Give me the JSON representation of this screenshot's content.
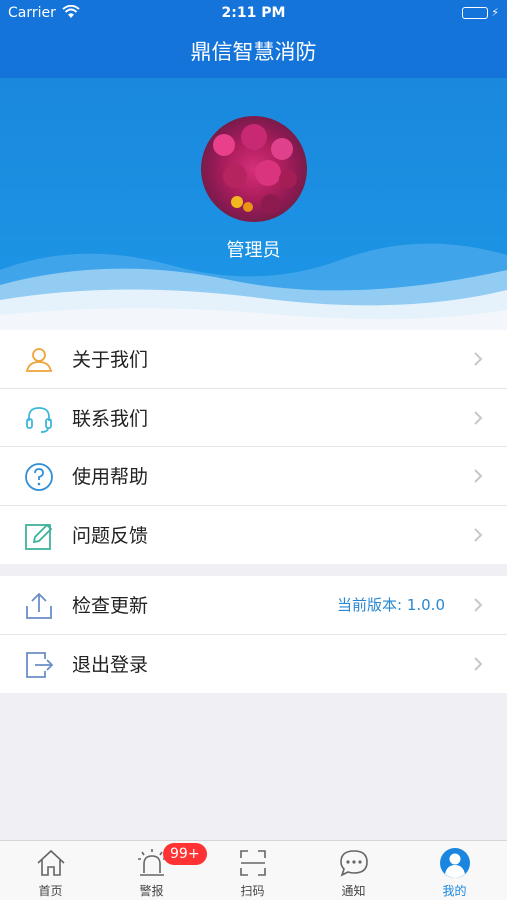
{
  "statusbar": {
    "carrier": "Carrier",
    "time": "2:11 PM"
  },
  "app": {
    "title": "鼎信智慧消防"
  },
  "profile": {
    "username": "管理员"
  },
  "menu_group_1": [
    {
      "label": "关于我们",
      "icon": "user-icon"
    },
    {
      "label": "联系我们",
      "icon": "headset-icon"
    },
    {
      "label": "使用帮助",
      "icon": "help-icon"
    },
    {
      "label": "问题反馈",
      "icon": "edit-icon"
    }
  ],
  "menu_group_2": [
    {
      "label": "检查更新",
      "icon": "upload-icon",
      "value": "当前版本: 1.0.0"
    },
    {
      "label": "退出登录",
      "icon": "logout-icon"
    }
  ],
  "tabbar": {
    "tabs": [
      {
        "label": "首页",
        "icon": "home-icon"
      },
      {
        "label": "警报",
        "icon": "alarm-icon",
        "badge": "99+"
      },
      {
        "label": "扫码",
        "icon": "scan-icon"
      },
      {
        "label": "通知",
        "icon": "chat-icon"
      },
      {
        "label": "我的",
        "icon": "profile-icon",
        "active": true
      }
    ]
  },
  "colors": {
    "primary": "#1574d9",
    "accent": "#1a86e0",
    "badge": "#ff3333"
  }
}
